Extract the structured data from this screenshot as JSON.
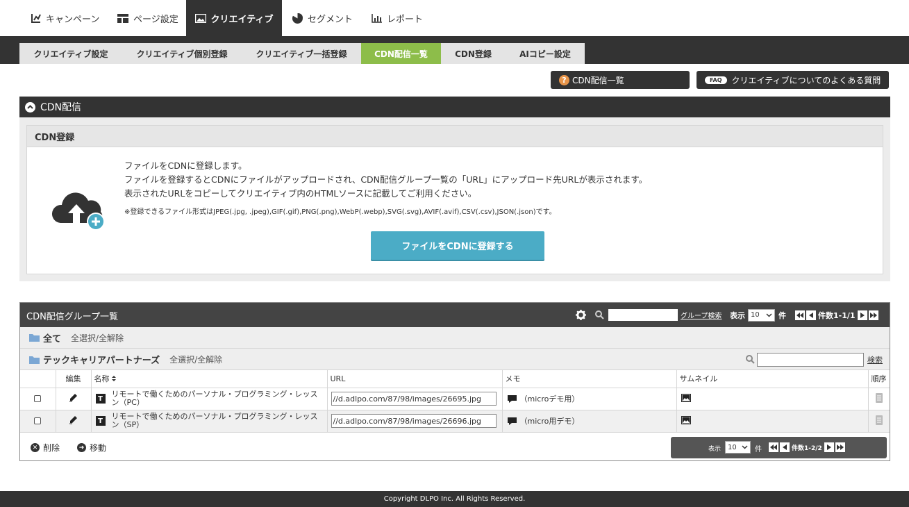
{
  "top_tabs": [
    {
      "label": "キャンペーン",
      "icon": "campaign-chart-icon"
    },
    {
      "label": "ページ設定",
      "icon": "page-layout-icon"
    },
    {
      "label": "クリエイティブ",
      "icon": "image-icon",
      "active": true
    },
    {
      "label": "セグメント",
      "icon": "pie-chart-icon"
    },
    {
      "label": "レポート",
      "icon": "bar-chart-icon"
    }
  ],
  "sub_tabs": [
    {
      "label": "クリエイティブ設定"
    },
    {
      "label": "クリエイティブ個別登録"
    },
    {
      "label": "クリエイティブ一括登録"
    },
    {
      "label": "CDN配信一覧",
      "active": true
    },
    {
      "label": "CDN登録"
    },
    {
      "label": "AIコピー設定"
    }
  ],
  "help_buttons": {
    "cdn_list": {
      "label": "CDN配信一覧",
      "icon_text": "?"
    },
    "faq": {
      "label": "クリエイティブについてのよくある質問",
      "pill": "FAQ"
    }
  },
  "cdn_section": {
    "title": "CDN配信",
    "box_title": "CDN登録",
    "desc_lines": [
      "ファイルをCDNに登録します。",
      "ファイルを登録するとCDNにファイルがアップロードされ、CDN配信グループ一覧の「URL」にアップロード先URLが表示されます。",
      "表示されたURLをコピーしてクリエイティブ内のHTMLソースに記載してご利用ください。"
    ],
    "note": "※登録できるファイル形式はJPEG(.jpg, .jpeg),GIF(.gif),PNG(.png),WebP(.webp),SVG(.svg),AVIF(.avif),CSV(.csv),JSON(.json)です。",
    "register_button": "ファイルをCDNに登録する"
  },
  "group_list": {
    "title": "CDN配信グループ一覧",
    "group_search_link": "グループ検索",
    "display_label": "表示",
    "per_page": "10",
    "count_unit": "件",
    "count_text": "件数1-1/1",
    "all_label": "全て",
    "select_all": "全選択/全解除",
    "folder_name": "テックキャリアパートナーズ",
    "folder_select_all": "全選択/全解除",
    "search_link": "検索",
    "columns": {
      "edit": "編集",
      "name": "名称",
      "url": "URL",
      "memo": "メモ",
      "thumb": "サムネイル",
      "order": "順序"
    },
    "rows": [
      {
        "name_line1": "リモートで働くためのパーソナル・プログラミング・レッス",
        "name_line2": "ン（PC）",
        "url": "//d.adlpo.com/87/98/images/26695.jpg",
        "memo": "（microデモ用）"
      },
      {
        "name_line1": "リモートで働くためのパーソナル・プログラミング・レッス",
        "name_line2": "ン（SP）",
        "url": "//d.adlpo.com/87/98/images/26696.jpg",
        "memo": "（micro用デモ）"
      }
    ],
    "delete_label": "削除",
    "move_label": "移動",
    "bottom_pager": {
      "display_label": "表示",
      "per_page": "10",
      "count_unit": "件",
      "count_text": "件数1-2/2"
    }
  },
  "footer": {
    "copyright": "Copyright DLPO Inc. All Rights Reserved."
  }
}
